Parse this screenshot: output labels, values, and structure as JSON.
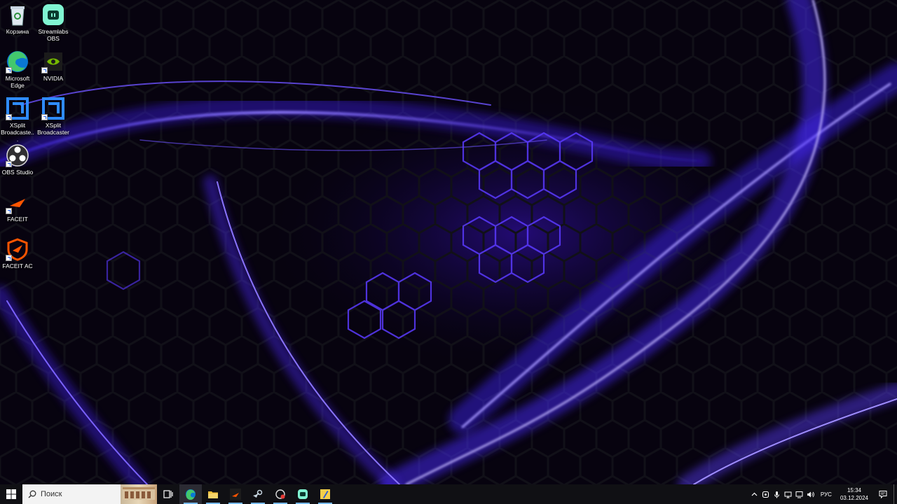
{
  "desktop": {
    "icons": [
      {
        "label": "Корзина",
        "icon": "recycle-bin-icon"
      },
      {
        "label": "Streamlabs OBS",
        "icon": "streamlabs-icon"
      },
      {
        "label": "Microsoft Edge",
        "icon": "edge-icon"
      },
      {
        "label": "NVIDIA",
        "icon": "nvidia-icon"
      },
      {
        "label": "XSplit Broadcaste...",
        "icon": "xsplit-icon"
      },
      {
        "label": "XSplit Broadcaster",
        "icon": "xsplit-icon"
      },
      {
        "label": "OBS Studio",
        "icon": "obs-icon"
      },
      {
        "label": "FACEIT",
        "icon": "faceit-icon"
      },
      {
        "label": "FACEIT AC",
        "icon": "faceit-ac-icon"
      }
    ]
  },
  "taskbar": {
    "search_placeholder": "Поиск",
    "apps": [
      "task-view-icon",
      "edge-icon",
      "file-explorer-icon",
      "faceit-icon",
      "steam-icon",
      "screen-recorder-icon",
      "streamlabs-icon",
      "pen-app-icon"
    ],
    "language": "РУС",
    "time": "15:34",
    "date": "03.12.2024"
  },
  "colors": {
    "wallpaper_accent": "#5a2cff",
    "taskbar_bg": "#101014",
    "running_indicator": "#76b9ed"
  }
}
